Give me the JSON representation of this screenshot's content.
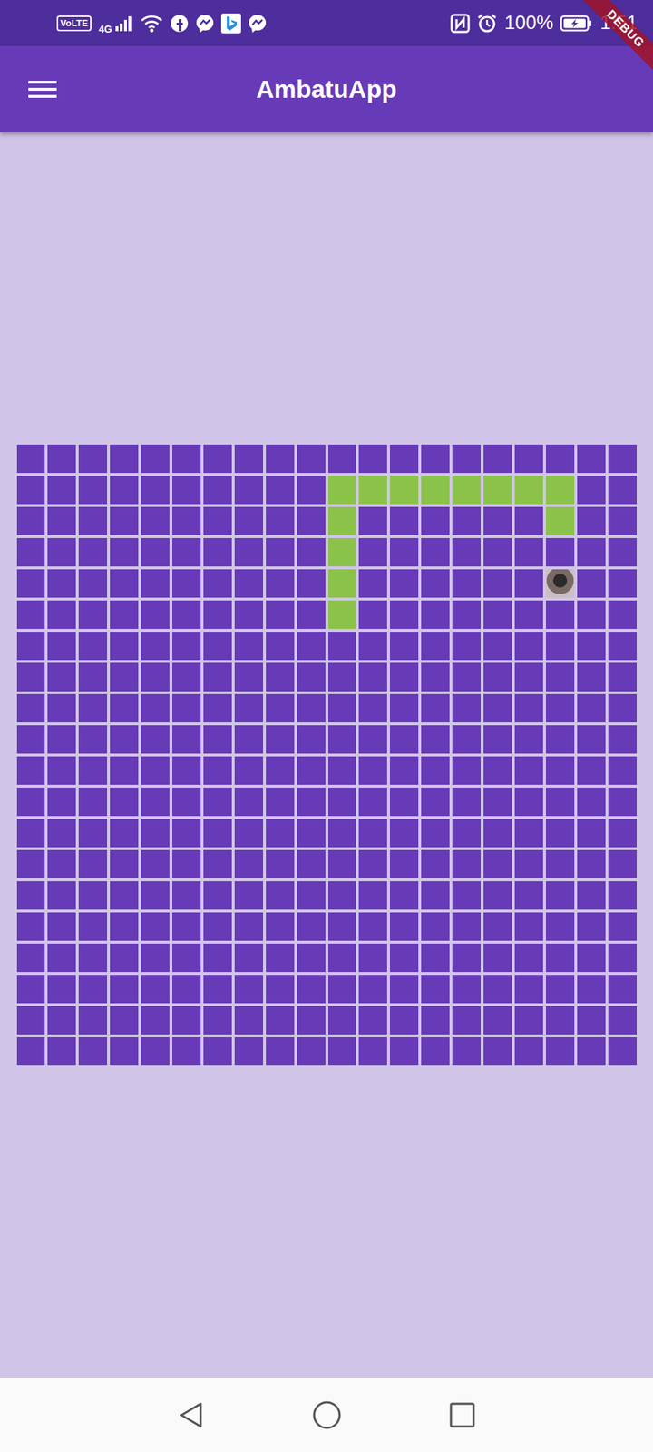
{
  "status_bar": {
    "volte": "VoLTE",
    "network": "4G",
    "battery": "100%",
    "time": "1:51"
  },
  "debug_banner": "DEBUG",
  "app_bar": {
    "title": "AmbatuApp"
  },
  "board": {
    "rows": 20,
    "columns": 20,
    "snake": [
      {
        "row": 5,
        "col": 10
      },
      {
        "row": 4,
        "col": 10
      },
      {
        "row": 3,
        "col": 10
      },
      {
        "row": 2,
        "col": 10
      },
      {
        "row": 1,
        "col": 10
      },
      {
        "row": 1,
        "col": 11
      },
      {
        "row": 1,
        "col": 12
      },
      {
        "row": 1,
        "col": 13
      },
      {
        "row": 1,
        "col": 14
      },
      {
        "row": 1,
        "col": 15
      },
      {
        "row": 1,
        "col": 16
      },
      {
        "row": 1,
        "col": 17
      },
      {
        "row": 2,
        "col": 17
      }
    ],
    "food": {
      "row": 4,
      "col": 17
    }
  }
}
